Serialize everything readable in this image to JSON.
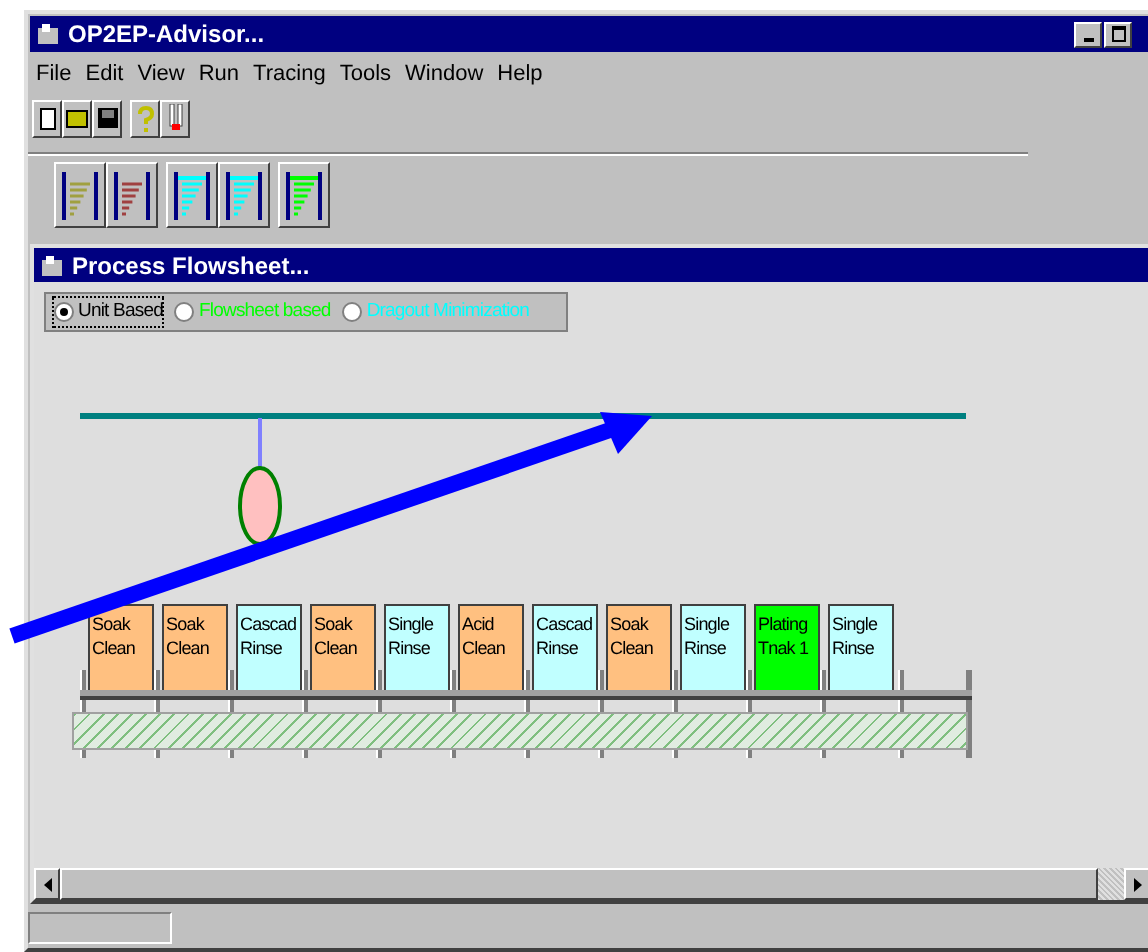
{
  "window": {
    "title": "OP2EP-Advisor..."
  },
  "menu": [
    "File",
    "Edit",
    "View",
    "Run",
    "Tracing",
    "Tools",
    "Window",
    "Help"
  ],
  "child_window": {
    "title": "Process Flowsheet..."
  },
  "modes": [
    {
      "label": "Unit Based",
      "selected": true,
      "color": "#000000"
    },
    {
      "label": "Flowsheet based",
      "selected": false,
      "color": "#00ff00"
    },
    {
      "label": "Dragout Minimization",
      "selected": false,
      "color": "#00ffff"
    }
  ],
  "tanks": [
    {
      "label": "Soak Clean",
      "color": "#ffc080"
    },
    {
      "label": "Soak Clean",
      "color": "#ffc080"
    },
    {
      "label": "Cascad Rinse",
      "color": "#c0ffff"
    },
    {
      "label": "Soak Clean",
      "color": "#ffc080"
    },
    {
      "label": "Single Rinse",
      "color": "#c0ffff"
    },
    {
      "label": "Acid Clean",
      "color": "#ffc080"
    },
    {
      "label": "Cascad Rinse",
      "color": "#c0ffff"
    },
    {
      "label": "Soak Clean",
      "color": "#ffc080"
    },
    {
      "label": "Single Rinse",
      "color": "#c0ffff"
    },
    {
      "label": "Plating Tnak 1",
      "color": "#00ff00"
    },
    {
      "label": "Single Rinse",
      "color": "#c0ffff"
    }
  ]
}
